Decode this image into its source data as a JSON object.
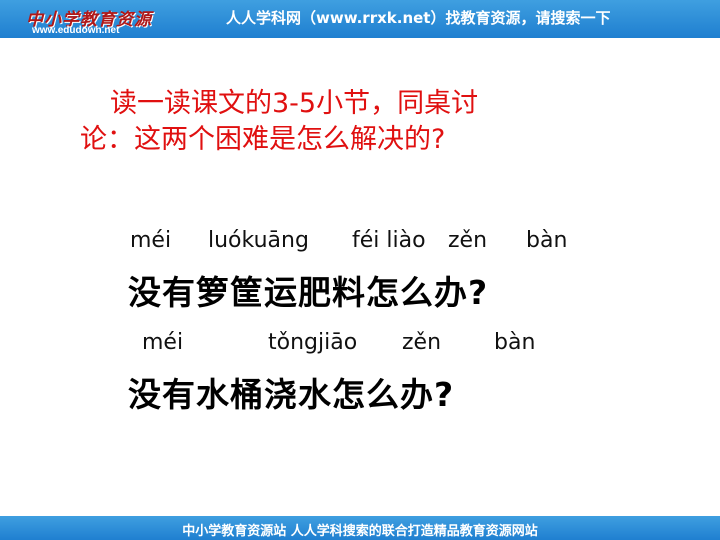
{
  "banner": {
    "logo_text": "中小学教育资源",
    "logo_url": "www.edudown.net",
    "slogan": "人人学科网（www.rrxk.net）找教育资源，请搜索一下"
  },
  "question": {
    "line1": "读一读课文的3-5小节，同桌讨",
    "line2": "论：这两个困难是怎么解决的?"
  },
  "sentences": [
    {
      "pinyin": [
        "méi",
        "luókuāng",
        "féi liào",
        "zěn",
        "bàn"
      ],
      "text": "没有箩筐运肥料怎么办?"
    },
    {
      "pinyin": [
        "méi",
        "tǒngjiāo",
        "zěn",
        "bàn"
      ],
      "text": "没有水桶浇水怎么办?"
    }
  ],
  "footer": {
    "text": "中小学教育资源站 人人学科搜索的联合打造精品教育资源网站"
  }
}
